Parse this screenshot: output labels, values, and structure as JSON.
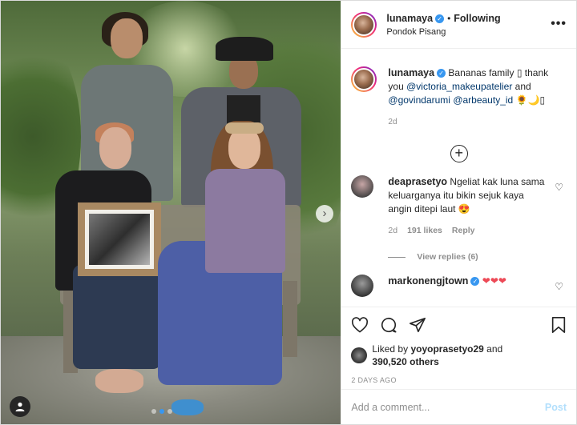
{
  "post": {
    "username": "lunamaya",
    "follow_status": "Following",
    "separator": "•",
    "location": "Pondok Pisang",
    "more_label": "•••"
  },
  "caption": {
    "username": "lunamaya",
    "text_start": "Bananas family ",
    "text_mid": " thank you ",
    "mention1": "@victoria_makeupatelier",
    "text_and": " and",
    "mention2": "@govindarumi",
    "mention3": "@arbeauty_id",
    "emoji_end": "🌻🌙",
    "time": "2d"
  },
  "load_more_label": "+",
  "comments": [
    {
      "username": "deaprasetyo",
      "text": "Ngeliat kak luna sama keluarganya itu bikin sejuk kaya angin ditepi laut 😍",
      "time": "2d",
      "likes": "191 likes",
      "reply": "Reply",
      "view_replies": "View replies (6)"
    },
    {
      "username": "markonengjtown",
      "text": "❤❤❤"
    }
  ],
  "actions": {
    "liked_by_prefix": "Liked by ",
    "liked_by_user": "yoyoprasetyo29",
    "liked_by_and": " and",
    "others_count": "390,520 others",
    "date": "2 DAYS AGO"
  },
  "add_comment": {
    "placeholder": "Add a comment...",
    "post_label": "Post"
  },
  "carousel": {
    "next_label": "›",
    "total": 3,
    "active": 2
  },
  "icons": [
    "verified-badge-icon",
    "more-options-icon",
    "add-circle-icon",
    "heart-icon",
    "comment-icon",
    "share-icon",
    "bookmark-icon",
    "tag-user-icon",
    "carousel-next-icon"
  ],
  "colors": {
    "link": "#00376b",
    "accent": "#3897f0",
    "red_heart": "#ed4956",
    "muted": "#8e8e8e",
    "post_disabled": "#b2dffc"
  }
}
